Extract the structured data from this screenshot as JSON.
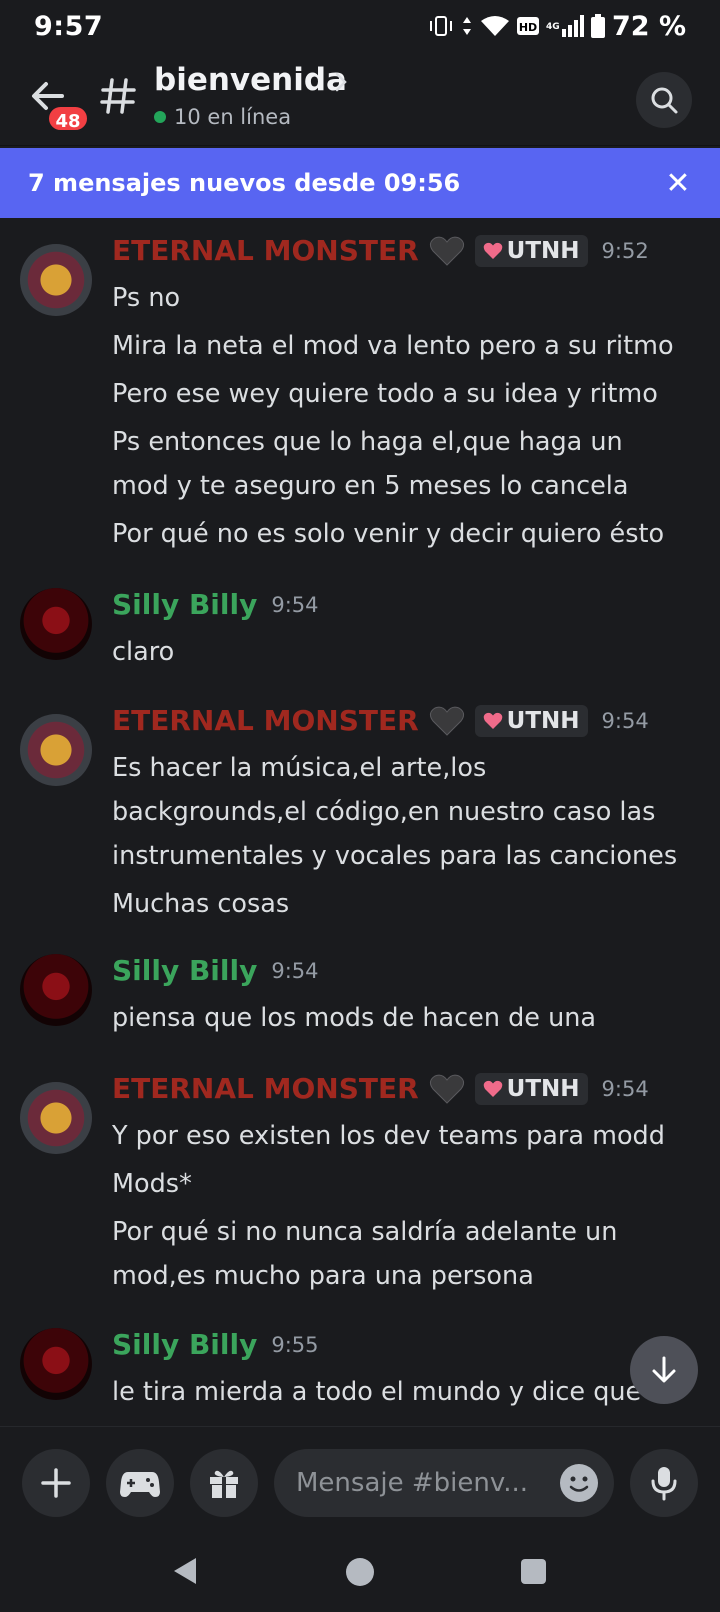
{
  "status_bar": {
    "time": "9:57",
    "battery": "72 %",
    "network": "4G",
    "hd": "HD"
  },
  "header": {
    "unread_badge": "48",
    "channel_name": "bienvenida",
    "online": "10 en línea"
  },
  "banner": {
    "text": "7 mensajes nuevos desde 09:56",
    "close": "✕"
  },
  "messages": [
    {
      "author": "ETERNAL MONSTER",
      "role": "UTNH",
      "time": "9:52",
      "lines": [
        "Ps no",
        "Mira la neta el mod va lento pero a su ritmo",
        "Pero ese wey quiere todo a su idea y ritmo",
        "Ps entonces que lo haga el,que haga un",
        "mod y te aseguro en 5 meses lo cancela",
        "Por qué no es solo venir y decir quiero ésto"
      ]
    },
    {
      "author": "Silly Billy",
      "time": "9:54",
      "lines": [
        "claro"
      ]
    },
    {
      "author": "ETERNAL MONSTER",
      "role": "UTNH",
      "time": "9:54",
      "lines": [
        "Es hacer la música,el arte,los",
        "backgrounds,el código,en nuestro caso las",
        "instrumentales y vocales para las canciones",
        "Muchas cosas"
      ]
    },
    {
      "author": "Silly Billy",
      "time": "9:54",
      "lines": [
        "piensa que los mods de hacen de una"
      ]
    },
    {
      "author": "ETERNAL MONSTER",
      "role": "UTNH",
      "time": "9:54",
      "lines": [
        "Y por eso existen los dev teams para modd",
        "Mods*",
        "Por qué si no nunca saldría adelante un",
        "mod,es mucho para una persona"
      ]
    },
    {
      "author": "Silly Billy",
      "time": "9:55",
      "lines": [
        "le tira mierda a todo el mundo y dice que"
      ]
    }
  ],
  "composer": {
    "placeholder": "Mensaje #bienv..."
  },
  "colors": {
    "background": "#1a1b1e",
    "blurple": "#5865f2",
    "eternal_name": "#a0281f",
    "silly_name": "#3ba55c",
    "badge_red": "#f23f43",
    "online_green": "#23a55a"
  },
  "icons": {
    "back": "back-arrow-icon",
    "hash": "hash-icon",
    "search": "search-icon",
    "close": "close-icon",
    "heart": "black-heart-icon",
    "scroll_down": "arrow-down-icon",
    "plus": "plus-icon",
    "gamepad": "gamepad-icon",
    "gift": "gift-icon",
    "emoji": "emoji-icon",
    "mic": "microphone-icon"
  }
}
